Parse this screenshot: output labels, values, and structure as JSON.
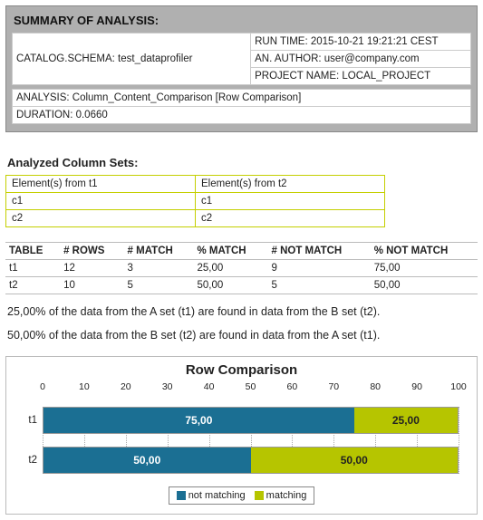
{
  "summary": {
    "title": "SUMMARY OF ANALYSIS:",
    "catalog_label": "CATALOG.SCHEMA: test_dataprofiler",
    "runtime": "RUN TIME: 2015-10-21 19:21:21 CEST",
    "author": "AN. AUTHOR: user@company.com",
    "project": "PROJECT NAME: LOCAL_PROJECT",
    "analysis": "ANALYSIS: Column_Content_Comparison [Row Comparison]",
    "duration": "DURATION: 0.0660"
  },
  "colsets": {
    "heading": "Analyzed Column Sets:",
    "h1": "Element(s) from t1",
    "h2": "Element(s) from t2",
    "rows": [
      {
        "a": "c1",
        "b": "c1"
      },
      {
        "a": "c2",
        "b": "c2"
      }
    ]
  },
  "stats": {
    "headers": {
      "table": "TABLE",
      "rows": "# ROWS",
      "match": "# MATCH",
      "pmatch": "% MATCH",
      "nmatch": "# NOT MATCH",
      "pnmatch": "% NOT MATCH"
    },
    "rows": [
      {
        "table": "t1",
        "rows": "12",
        "match": "3",
        "pmatch": "25,00",
        "nmatch": "9",
        "pnmatch": "75,00"
      },
      {
        "table": "t2",
        "rows": "10",
        "match": "5",
        "pmatch": "50,00",
        "nmatch": "5",
        "pnmatch": "50,00"
      }
    ]
  },
  "sentences": {
    "s1": "25,00% of the data from the A set (t1) are found in data from the B set (t2).",
    "s2": "50,00% of the data from the B set (t2) are found in data from the A set (t1)."
  },
  "chart_data": {
    "type": "bar",
    "title": "Row Comparison",
    "orientation": "horizontal",
    "stacked": true,
    "xlabel": "",
    "ylabel": "",
    "xlim": [
      0,
      100
    ],
    "xticks": [
      0,
      10,
      20,
      30,
      40,
      50,
      60,
      70,
      80,
      90,
      100
    ],
    "categories": [
      "t1",
      "t2"
    ],
    "series": [
      {
        "name": "not matching",
        "color": "#1b6f93",
        "values": [
          75.0,
          50.0
        ],
        "labels": [
          "75,00",
          "50,00"
        ]
      },
      {
        "name": "matching",
        "color": "#b6c500",
        "values": [
          25.0,
          50.0
        ],
        "labels": [
          "25,00",
          "50,00"
        ]
      }
    ],
    "legend": {
      "position": "bottom",
      "items": [
        "not matching",
        "matching"
      ]
    }
  }
}
